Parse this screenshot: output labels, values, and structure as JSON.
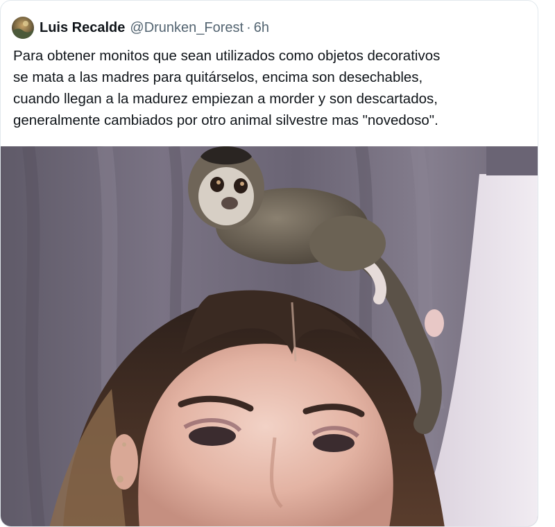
{
  "tweet": {
    "author_name": "Luis Recalde",
    "handle": "@Drunken_Forest",
    "separator": "·",
    "timestamp": "6h",
    "text_lines": [
      "Para obtener monitos que sean utilizados como objetos decorativos",
      "se mata a las madres para quitárselos, encima son desechables,",
      "cuando llegan a la madurez empiezan a morder y son descartados,",
      "generalmente cambiados por otro animal silvestre mas \"novedoso\"."
    ]
  },
  "colors": {
    "name": "#0f1419",
    "secondary": "#536471",
    "border": "#e1e8ed",
    "curtain": "#6e6777",
    "wall": "#e7dfe9"
  }
}
